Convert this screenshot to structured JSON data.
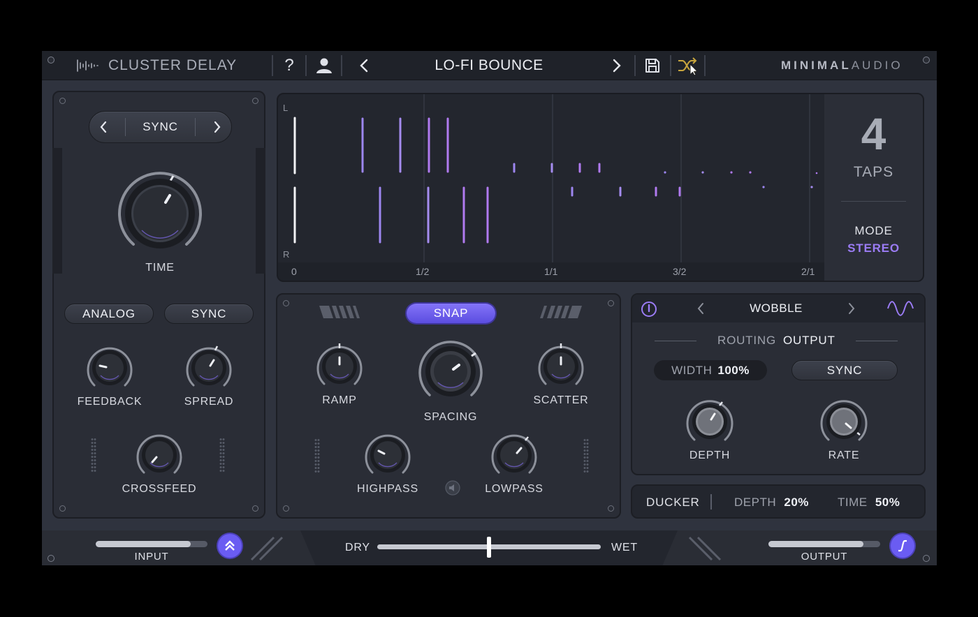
{
  "header": {
    "plugin_name": "CLUSTER DELAY",
    "preset_name": "LO-FI BOUNCE",
    "brand_bold": "MINIMAL",
    "brand_light": "AUDIO",
    "icons": [
      "waveform-logo-icon",
      "help-icon",
      "user-icon",
      "chevron-left-icon",
      "chevron-right-icon",
      "save-icon",
      "shuffle-icon"
    ]
  },
  "time_section": {
    "mode_label": "SYNC",
    "time_label": "TIME",
    "analog_label": "ANALOG",
    "sync_label": "SYNC",
    "feedback_label": "FEEDBACK",
    "spread_label": "SPREAD",
    "crossfeed_label": "CROSSFEED"
  },
  "tap_display": {
    "left_channel": "L",
    "right_channel": "R",
    "axis_ticks": [
      "0",
      "1/2",
      "1/1",
      "3/2",
      "2/1"
    ],
    "tap_count": "4",
    "taps_label": "TAPS",
    "mode_label": "MODE",
    "mode_value": "STEREO"
  },
  "shape_section": {
    "snap_label": "SNAP",
    "ramp_label": "RAMP",
    "spacing_label": "SPACING",
    "scatter_label": "SCATTER",
    "highpass_label": "HIGHPASS",
    "lowpass_label": "LOWPASS"
  },
  "modulation": {
    "preset_name": "WOBBLE",
    "routing_label": "ROUTING",
    "routing_value": "OUTPUT",
    "width_label": "WIDTH",
    "width_value": "100%",
    "sync_label": "SYNC",
    "depth_label": "DEPTH",
    "rate_label": "RATE"
  },
  "ducker": {
    "title": "DUCKER",
    "depth_label": "DEPTH",
    "depth_value": "20%",
    "time_label": "TIME",
    "time_value": "50%"
  },
  "footer": {
    "input_label": "INPUT",
    "dry_label": "DRY",
    "wet_label": "WET",
    "output_label": "OUTPUT",
    "input_level": 0.85,
    "dry_wet_mix": 0.5,
    "output_level": 0.85
  },
  "colors": {
    "accent": "#9b7cf5",
    "accent_button": "#6a5cf2",
    "background": "#2f333e",
    "header": "#1f2229"
  }
}
